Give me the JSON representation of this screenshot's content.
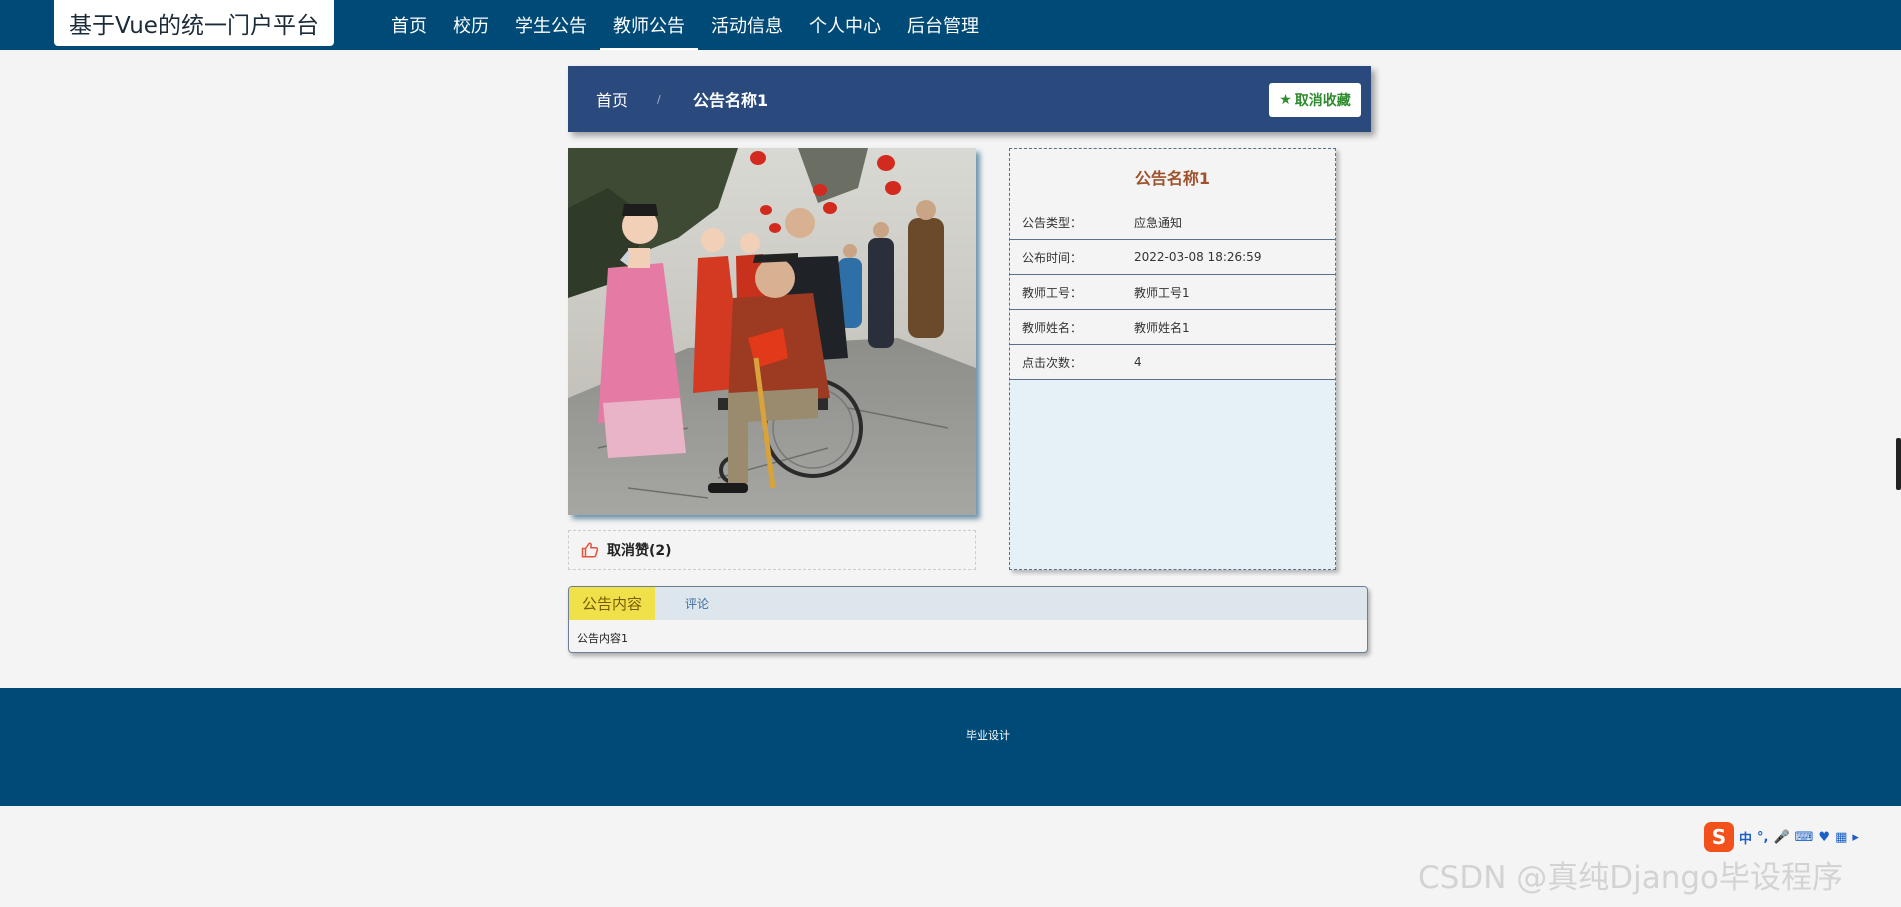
{
  "header": {
    "brand": "基于Vue的统一门户平台",
    "nav": [
      {
        "label": "首页",
        "active": false
      },
      {
        "label": "校历",
        "active": false
      },
      {
        "label": "学生公告",
        "active": false
      },
      {
        "label": "教师公告",
        "active": true
      },
      {
        "label": "活动信息",
        "active": false
      },
      {
        "label": "个人中心",
        "active": false
      },
      {
        "label": "后台管理",
        "active": false
      }
    ]
  },
  "breadcrumb": {
    "home": "首页",
    "separator": "/",
    "current": "公告名称1"
  },
  "favorite_button": {
    "label": "取消收藏"
  },
  "like": {
    "label": "取消赞(2)"
  },
  "info": {
    "title": "公告名称1",
    "rows": [
      {
        "key": "公告类型：",
        "value": "应急通知"
      },
      {
        "key": "公布时间：",
        "value": "2022-03-08 18:26:59"
      },
      {
        "key": "教师工号：",
        "value": "教师工号1"
      },
      {
        "key": "教师姓名：",
        "value": "教师姓名1"
      },
      {
        "key": "点击次数：",
        "value": "4"
      }
    ]
  },
  "tabs": {
    "items": [
      {
        "label": "公告内容",
        "active": true
      },
      {
        "label": "评论",
        "active": false
      }
    ],
    "content": "公告内容1"
  },
  "footer": {
    "text": "毕业设计"
  },
  "tray": {
    "ime": "中",
    "punct": "°,"
  },
  "watermark": "CSDN @真纯Django毕设程序",
  "colors": {
    "nav_bg": "#004a77",
    "breadcrumb_bg": "#2a4a7e",
    "active_tab": "#f0e14a",
    "info_title": "#a0522d",
    "favorite_green": "#2e8b2e"
  }
}
